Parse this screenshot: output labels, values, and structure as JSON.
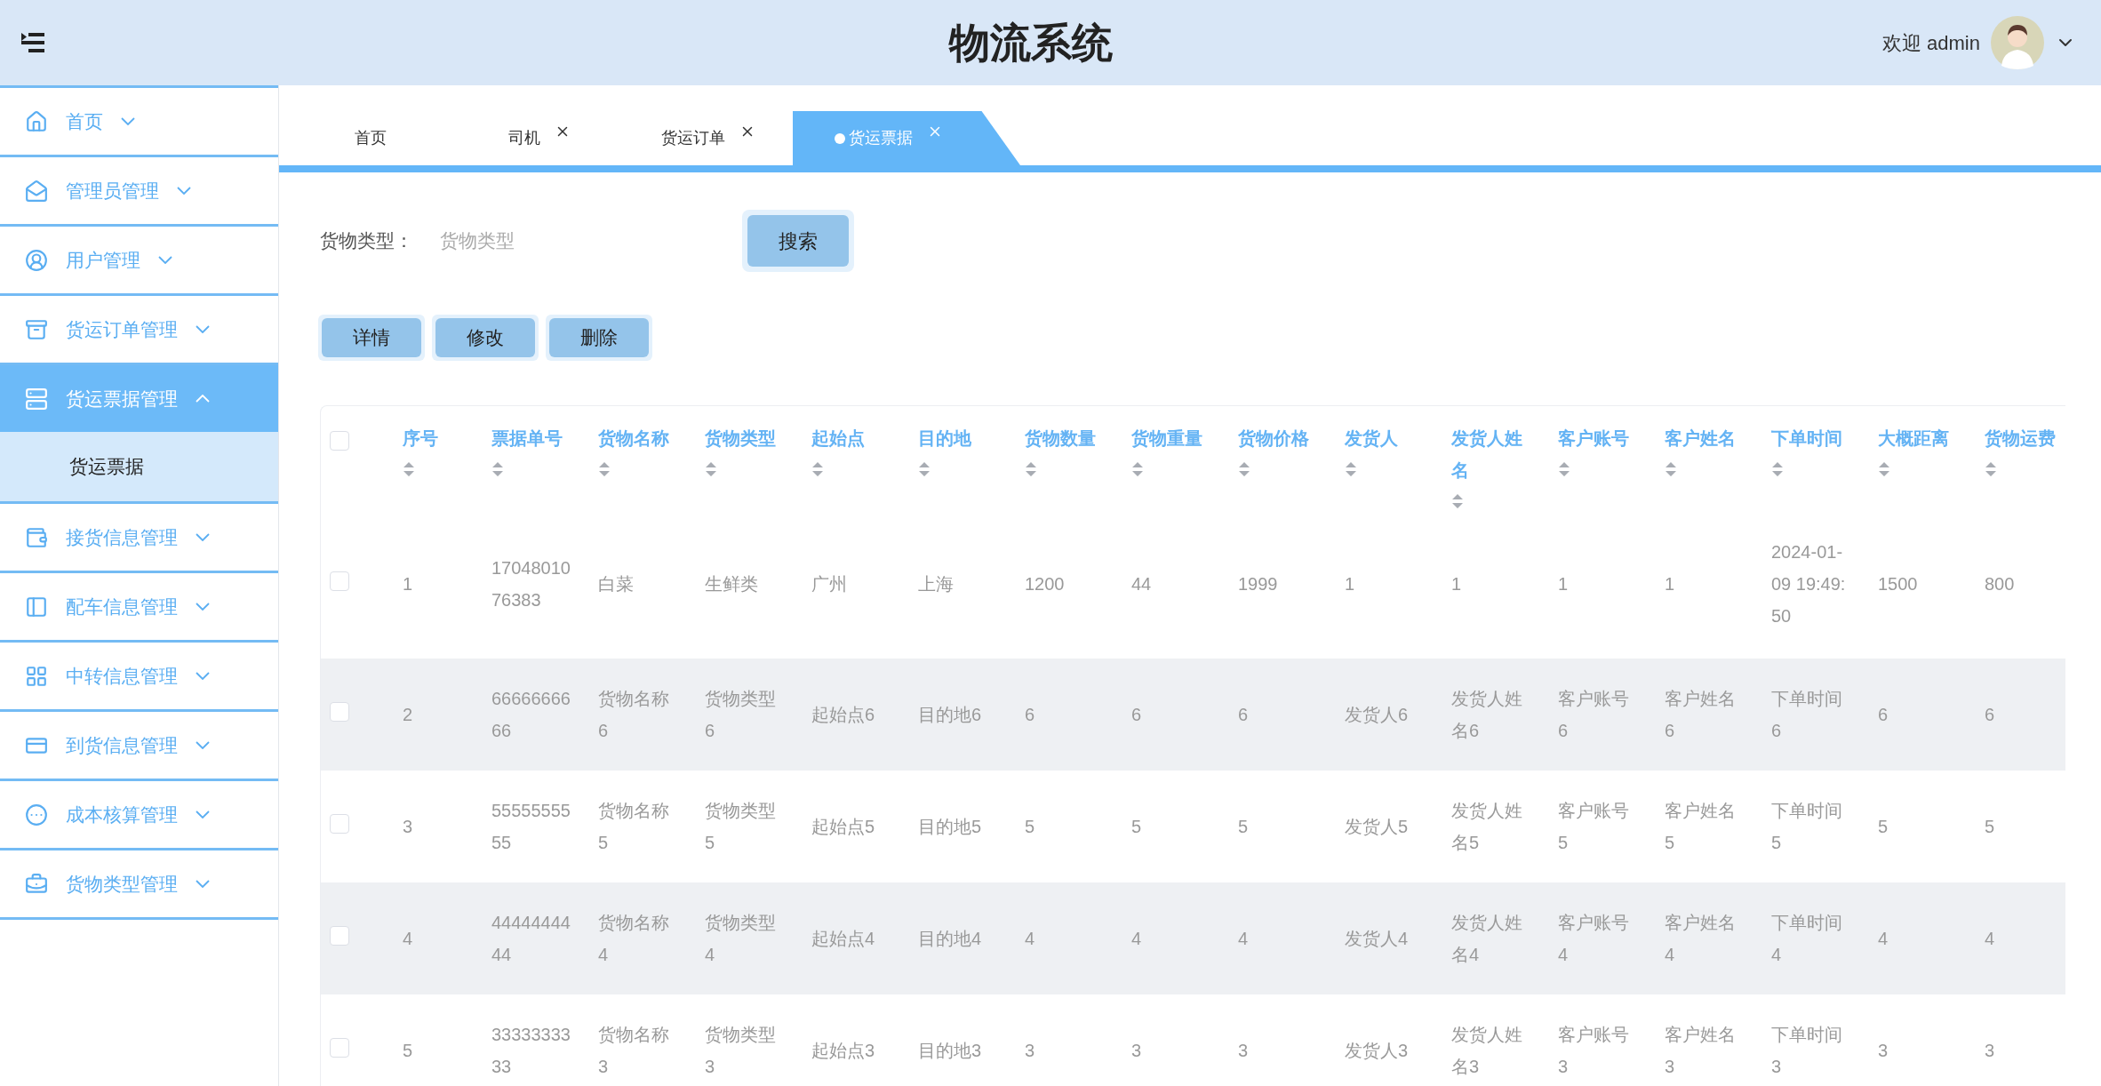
{
  "header": {
    "title": "物流系统",
    "welcome": "欢迎 admin"
  },
  "sidebar": {
    "items": [
      {
        "label": "首页",
        "expanded": false,
        "selected": false
      },
      {
        "label": "管理员管理",
        "expanded": false,
        "selected": false
      },
      {
        "label": "用户管理",
        "expanded": false,
        "selected": false
      },
      {
        "label": "货运订单管理",
        "expanded": false,
        "selected": false
      },
      {
        "label": "货运票据管理",
        "expanded": true,
        "selected": true,
        "children": [
          {
            "label": "货运票据",
            "selected": true
          }
        ]
      },
      {
        "label": "接货信息管理",
        "expanded": false,
        "selected": false
      },
      {
        "label": "配车信息管理",
        "expanded": false,
        "selected": false
      },
      {
        "label": "中转信息管理",
        "expanded": false,
        "selected": false
      },
      {
        "label": "到货信息管理",
        "expanded": false,
        "selected": false
      },
      {
        "label": "成本核算管理",
        "expanded": false,
        "selected": false
      },
      {
        "label": "货物类型管理",
        "expanded": false,
        "selected": false
      }
    ]
  },
  "tabs": [
    {
      "label": "首页",
      "selected": false,
      "closable": false
    },
    {
      "label": "司机",
      "selected": false,
      "closable": true
    },
    {
      "label": "货运订单",
      "selected": false,
      "closable": true
    },
    {
      "label": "货运票据",
      "selected": true,
      "closable": true
    }
  ],
  "search": {
    "label": "货物类型：",
    "placeholder": "货物类型",
    "button": "搜索"
  },
  "actions": [
    "详情",
    "修改",
    "删除"
  ],
  "table": {
    "select_all_checked": false,
    "columns": [
      "序号",
      "票据单号",
      "货物名称",
      "货物类型",
      "起始点",
      "目的地",
      "货物数量",
      "货物重量",
      "货物价格",
      "发货人",
      "发货人姓名",
      "客户账号",
      "客户姓名",
      "下单时间",
      "大概距离",
      "货物运费"
    ],
    "rows": [
      {
        "checked": false,
        "cells": [
          "1",
          "1704801076383",
          "白菜",
          "生鲜类",
          "广州",
          "上海",
          "1200",
          "44",
          "1999",
          "1",
          "1",
          "1",
          "1",
          "2024-01-09 19:49:50",
          "1500",
          "800"
        ]
      },
      {
        "checked": false,
        "cells": [
          "2",
          "6666666666",
          "货物名称6",
          "货物类型6",
          "起始点6",
          "目的地6",
          "6",
          "6",
          "6",
          "发货人6",
          "发货人姓名6",
          "客户账号6",
          "客户姓名6",
          "下单时间6",
          "6",
          "6"
        ]
      },
      {
        "checked": false,
        "cells": [
          "3",
          "5555555555",
          "货物名称5",
          "货物类型5",
          "起始点5",
          "目的地5",
          "5",
          "5",
          "5",
          "发货人5",
          "发货人姓名5",
          "客户账号5",
          "客户姓名5",
          "下单时间5",
          "5",
          "5"
        ]
      },
      {
        "checked": false,
        "cells": [
          "4",
          "4444444444",
          "货物名称4",
          "货物类型4",
          "起始点4",
          "目的地4",
          "4",
          "4",
          "4",
          "发货人4",
          "发货人姓名4",
          "客户账号4",
          "客户姓名4",
          "下单时间4",
          "4",
          "4"
        ]
      },
      {
        "checked": false,
        "cells": [
          "5",
          "3333333333",
          "货物名称3",
          "货物类型3",
          "起始点3",
          "目的地3",
          "3",
          "3",
          "3",
          "发货人3",
          "发货人姓名3",
          "客户账号3",
          "客户姓名3",
          "下单时间3",
          "3",
          "3"
        ]
      }
    ]
  }
}
